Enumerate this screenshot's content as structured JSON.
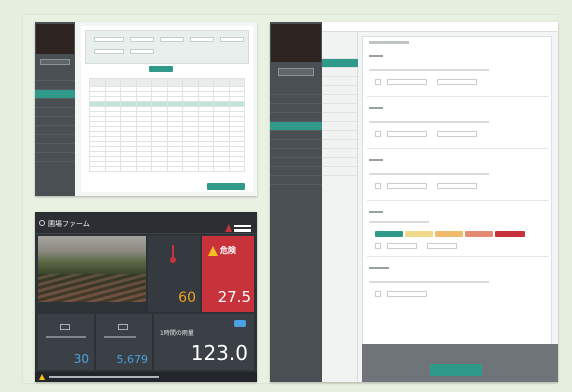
{
  "colors": {
    "accent": "#2f9a8a",
    "alert_red": "#c8323a",
    "dark_panel": "#2d3236",
    "sidebar": "#4a4f54",
    "value_orange": "#f0a020",
    "value_blue": "#4aa0e0"
  },
  "dashboard": {
    "title": "圃場ファーム",
    "alert_label": "危険",
    "temperature_value": "27.5",
    "humidity_value": "60",
    "metric_a_value": "30",
    "metric_b_value": "5,679",
    "metric_c_label": "1時間の雨量",
    "metric_c_value": "123.0"
  }
}
